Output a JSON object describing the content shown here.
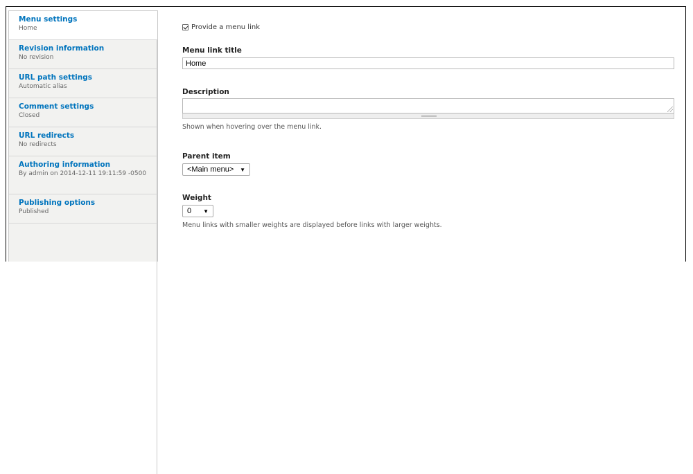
{
  "vertical_tabs": [
    {
      "title": "Menu settings",
      "summary": "Home"
    },
    {
      "title": "Revision information",
      "summary": "No revision"
    },
    {
      "title": "URL path settings",
      "summary": "Automatic alias"
    },
    {
      "title": "Comment settings",
      "summary": "Closed"
    },
    {
      "title": "URL redirects",
      "summary": "No redirects"
    },
    {
      "title": "Authoring information",
      "summary": "By admin on 2014-12-11 19:11:59 -0500"
    },
    {
      "title": "Publishing options",
      "summary": "Published"
    }
  ],
  "menu_settings": {
    "provide_menu_link_label": "Provide a menu link",
    "provide_menu_link_checked": true,
    "menu_link_title_label": "Menu link title",
    "menu_link_title_value": "Home",
    "description_label": "Description",
    "description_value": "",
    "description_help": "Shown when hovering over the menu link.",
    "parent_item_label": "Parent item",
    "parent_item_value": "<Main menu>",
    "weight_label": "Weight",
    "weight_value": "0",
    "weight_help": "Menu links with smaller weights are displayed before links with larger weights."
  },
  "icons": {
    "checkbox": "checkmark-icon",
    "select_caret": "caret-down-icon",
    "textarea_resize": "resize-grip-icon"
  },
  "colors": {
    "link": "#0074bd",
    "tab_background": "#f2f2f0"
  }
}
